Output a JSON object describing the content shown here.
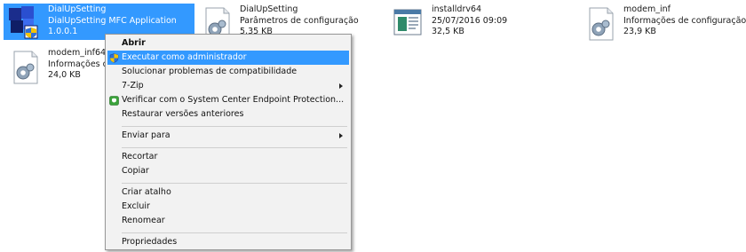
{
  "files": [
    {
      "name": "DialUpSetting",
      "line2": "DialUpSetting MFC Application",
      "line3": "1.0.0.1",
      "icon": "application-icon",
      "selected": true
    },
    {
      "name": "DialUpSetting",
      "line2": "Parâmetros de configuração",
      "line3": "5,35 KB",
      "icon": "config-file-icon"
    },
    {
      "name": "installdrv64",
      "line2": "25/07/2016 09:09",
      "line3": "32,5 KB",
      "icon": "executable-icon"
    },
    {
      "name": "modem_inf",
      "line2": "Informações de configuração",
      "line3": "23,9 KB",
      "icon": "config-file-icon"
    },
    {
      "name": "modem_inf64",
      "line2": "Informações d",
      "line3": "24,0 KB",
      "icon": "config-file-icon"
    }
  ],
  "context_menu": {
    "items": [
      {
        "label": "Abrir",
        "bold": true
      },
      {
        "label": "Executar como administrador",
        "icon": "uac-shield-icon",
        "highlighted": true
      },
      {
        "label": "Solucionar problemas de compatibilidade"
      },
      {
        "label": "7-Zip",
        "submenu": true
      },
      {
        "label": "Verificar com o System Center Endpoint Protection...",
        "icon": "endpoint-protection-icon"
      },
      {
        "label": "Restaurar versões anteriores"
      },
      {
        "label": "Enviar para",
        "submenu": true
      },
      {
        "label": "Recortar"
      },
      {
        "label": "Copiar"
      },
      {
        "label": "Criar atalho"
      },
      {
        "label": "Excluir"
      },
      {
        "label": "Renomear"
      },
      {
        "label": "Propriedades"
      }
    ]
  },
  "colors": {
    "selection": "#3399ff",
    "menu_bg": "#f2f2f2"
  }
}
